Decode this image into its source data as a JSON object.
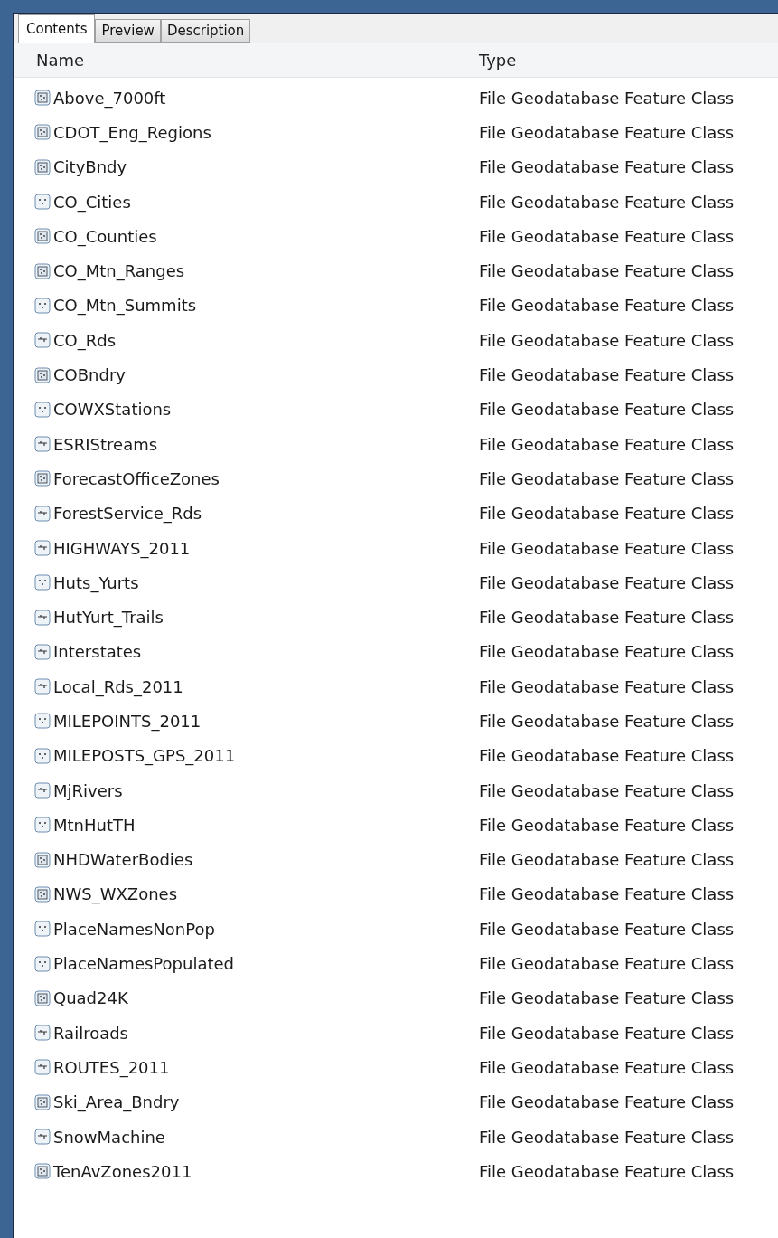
{
  "tabs": [
    {
      "label": "Contents",
      "selected": true
    },
    {
      "label": "Preview",
      "selected": false
    },
    {
      "label": "Description",
      "selected": false
    }
  ],
  "columns": [
    "Name",
    "Type"
  ],
  "rows": [
    {
      "kind": "polygon",
      "name": "Above_7000ft",
      "type": "File Geodatabase Feature Class"
    },
    {
      "kind": "polygon",
      "name": "CDOT_Eng_Regions",
      "type": "File Geodatabase Feature Class"
    },
    {
      "kind": "polygon",
      "name": "CityBndy",
      "type": "File Geodatabase Feature Class"
    },
    {
      "kind": "point",
      "name": "CO_Cities",
      "type": "File Geodatabase Feature Class"
    },
    {
      "kind": "polygon",
      "name": "CO_Counties",
      "type": "File Geodatabase Feature Class"
    },
    {
      "kind": "polygon",
      "name": "CO_Mtn_Ranges",
      "type": "File Geodatabase Feature Class"
    },
    {
      "kind": "point",
      "name": "CO_Mtn_Summits",
      "type": "File Geodatabase Feature Class"
    },
    {
      "kind": "line",
      "name": "CO_Rds",
      "type": "File Geodatabase Feature Class"
    },
    {
      "kind": "polygon",
      "name": "COBndry",
      "type": "File Geodatabase Feature Class"
    },
    {
      "kind": "point",
      "name": "COWXStations",
      "type": "File Geodatabase Feature Class"
    },
    {
      "kind": "line",
      "name": "ESRIStreams",
      "type": "File Geodatabase Feature Class"
    },
    {
      "kind": "polygon",
      "name": "ForecastOfficeZones",
      "type": "File Geodatabase Feature Class"
    },
    {
      "kind": "line",
      "name": "ForestService_Rds",
      "type": "File Geodatabase Feature Class"
    },
    {
      "kind": "line",
      "name": "HIGHWAYS_2011",
      "type": "File Geodatabase Feature Class"
    },
    {
      "kind": "point",
      "name": "Huts_Yurts",
      "type": "File Geodatabase Feature Class"
    },
    {
      "kind": "line",
      "name": "HutYurt_Trails",
      "type": "File Geodatabase Feature Class"
    },
    {
      "kind": "line",
      "name": "Interstates",
      "type": "File Geodatabase Feature Class"
    },
    {
      "kind": "line",
      "name": "Local_Rds_2011",
      "type": "File Geodatabase Feature Class"
    },
    {
      "kind": "point",
      "name": "MILEPOINTS_2011",
      "type": "File Geodatabase Feature Class"
    },
    {
      "kind": "point",
      "name": "MILEPOSTS_GPS_2011",
      "type": "File Geodatabase Feature Class"
    },
    {
      "kind": "line",
      "name": "MjRivers",
      "type": "File Geodatabase Feature Class"
    },
    {
      "kind": "point",
      "name": "MtnHutTH",
      "type": "File Geodatabase Feature Class"
    },
    {
      "kind": "polygon",
      "name": "NHDWaterBodies",
      "type": "File Geodatabase Feature Class"
    },
    {
      "kind": "polygon",
      "name": "NWS_WXZones",
      "type": "File Geodatabase Feature Class"
    },
    {
      "kind": "point",
      "name": "PlaceNamesNonPop",
      "type": "File Geodatabase Feature Class"
    },
    {
      "kind": "point",
      "name": "PlaceNamesPopulated",
      "type": "File Geodatabase Feature Class"
    },
    {
      "kind": "polygon",
      "name": "Quad24K",
      "type": "File Geodatabase Feature Class"
    },
    {
      "kind": "line",
      "name": "Railroads",
      "type": "File Geodatabase Feature Class"
    },
    {
      "kind": "line",
      "name": "ROUTES_2011",
      "type": "File Geodatabase Feature Class"
    },
    {
      "kind": "polygon",
      "name": "Ski_Area_Bndry",
      "type": "File Geodatabase Feature Class"
    },
    {
      "kind": "line",
      "name": "SnowMachine",
      "type": "File Geodatabase Feature Class"
    },
    {
      "kind": "polygon",
      "name": "TenAvZones2011",
      "type": "File Geodatabase Feature Class"
    }
  ]
}
